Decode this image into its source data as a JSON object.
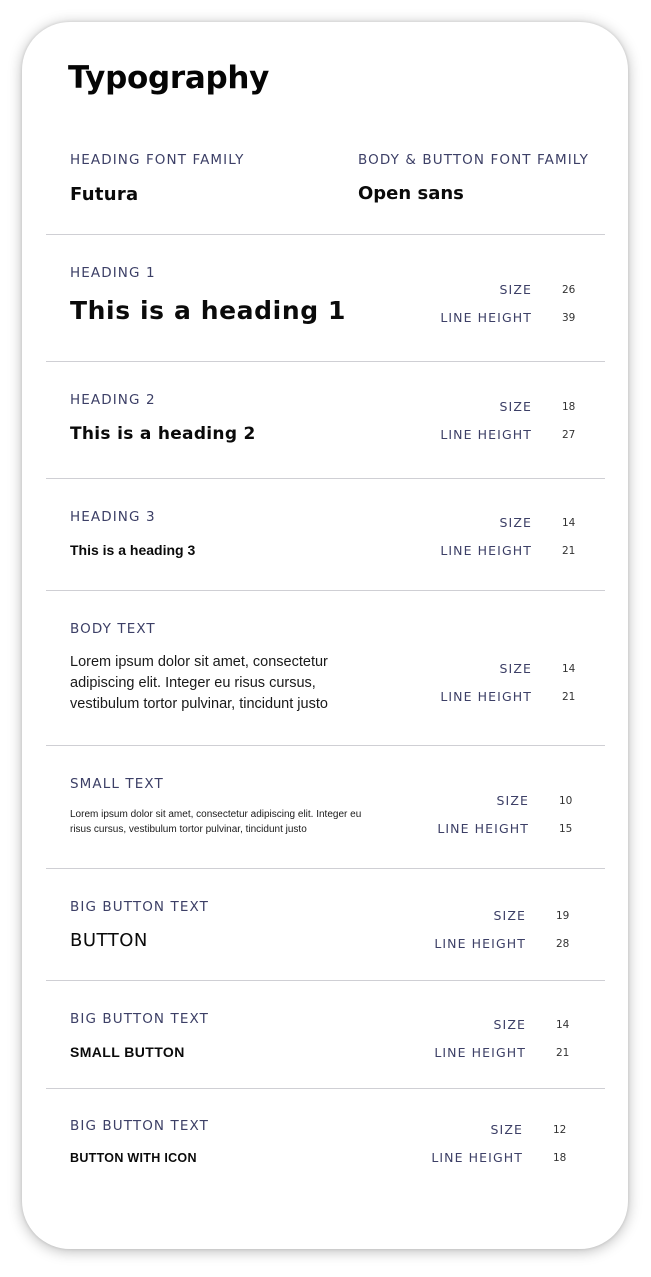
{
  "title": "Typography",
  "fonts": {
    "heading_label": "HEADING FONT FAMILY",
    "heading_value": "Futura",
    "body_label": "BODY & BUTTON FONT FAMILY",
    "body_value": "Open sans"
  },
  "metric_labels": {
    "size": "SIZE",
    "line_height": "LINE HEIGHT"
  },
  "styles": [
    {
      "label": "HEADING 1",
      "sample": "This is a heading 1",
      "size": "26",
      "line_height": "39"
    },
    {
      "label": "HEADING 2",
      "sample": "This is a heading 2",
      "size": "18",
      "line_height": "27"
    },
    {
      "label": "HEADING 3",
      "sample": "This is a heading 3",
      "size": "14",
      "line_height": "21"
    },
    {
      "label": "BODY TEXT",
      "sample": "Lorem ipsum dolor sit amet, consectetur adipiscing elit. Integer eu risus cursus, vestibulum tortor pulvinar, tincidunt justo",
      "size": "14",
      "line_height": "21"
    },
    {
      "label": "SMALL TEXT",
      "sample": "Lorem ipsum dolor sit amet, consectetur adipiscing elit. Integer eu risus cursus, vestibulum tortor pulvinar, tincidunt justo",
      "size": "10",
      "line_height": "15"
    },
    {
      "label": "BIG BUTTON TEXT",
      "sample": "BUTTON",
      "size": "19",
      "line_height": "28"
    },
    {
      "label": "BIG BUTTON TEXT",
      "sample": "SMALL BUTTON",
      "size": "14",
      "line_height": "21"
    },
    {
      "label": "BIG BUTTON TEXT",
      "sample": "BUTTON WITH ICON",
      "size": "12",
      "line_height": "18"
    }
  ]
}
